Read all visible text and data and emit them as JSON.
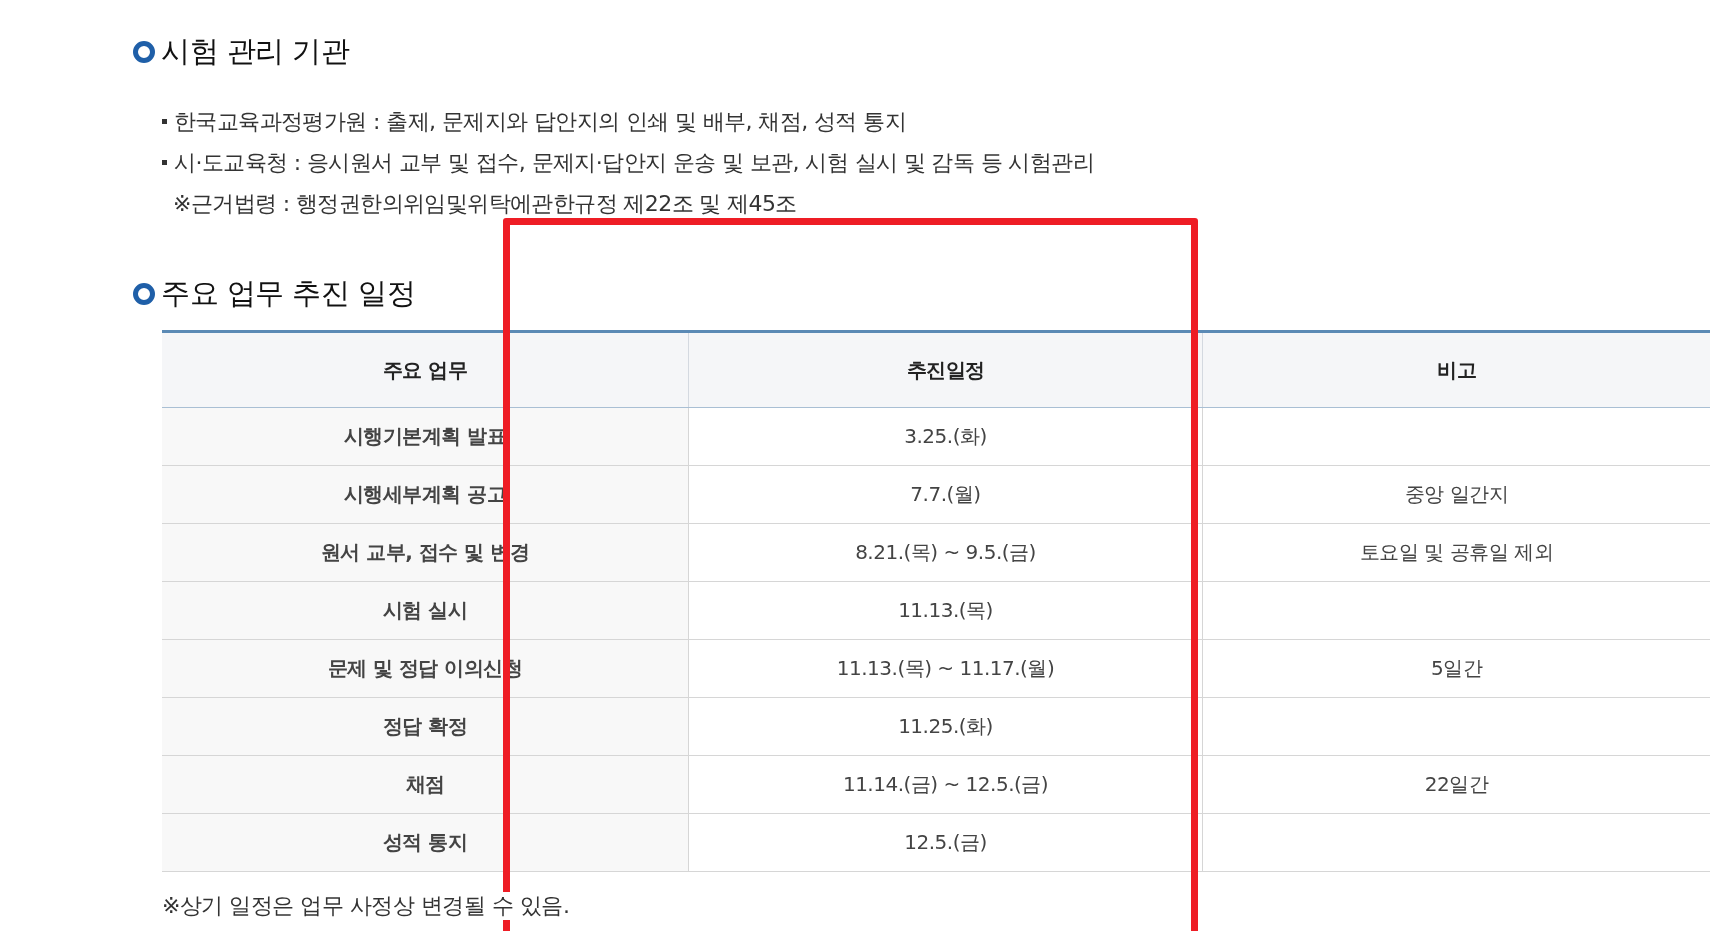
{
  "sections": [
    {
      "title": "시험 관리 기관",
      "items": [
        {
          "kind": "bullet",
          "text": "한국교육과정평가원 : 출제, 문제지와 답안지의 인쇄 및 배부, 채점, 성적 통지"
        },
        {
          "kind": "bullet",
          "text": "시·도교육청 : 응시원서 교부 및 접수, 문제지·답안지 운송 및 보관, 시험 실시 및 감독 등 시험관리"
        },
        {
          "kind": "note",
          "text": "※근거법령 : 행정권한의위임및위탁에관한규정 제22조 및 제45조"
        }
      ]
    },
    {
      "title": "주요 업무 추진 일정",
      "table": {
        "columns": [
          "주요 업무",
          "추진일정",
          "비고"
        ],
        "rows": [
          [
            "시행기본계획 발표",
            "3.25.(화)",
            ""
          ],
          [
            "시행세부계획 공고",
            "7.7.(월)",
            "중앙 일간지"
          ],
          [
            "원서 교부, 접수 및 변경",
            "8.21.(목) ~ 9.5.(금)",
            "토요일 및 공휴일 제외"
          ],
          [
            "시험 실시",
            "11.13.(목)",
            ""
          ],
          [
            "문제 및 정답 이의신청",
            "11.13.(목) ~ 11.17.(월)",
            "5일간"
          ],
          [
            "정답 확정",
            "11.25.(화)",
            ""
          ],
          [
            "채점",
            "11.14.(금) ~ 12.5.(금)",
            "22일간"
          ],
          [
            "성적 통지",
            "12.5.(금)",
            ""
          ]
        ]
      },
      "footnote": "※상기 일정은 업무 사정상 변경될 수 있음."
    }
  ]
}
